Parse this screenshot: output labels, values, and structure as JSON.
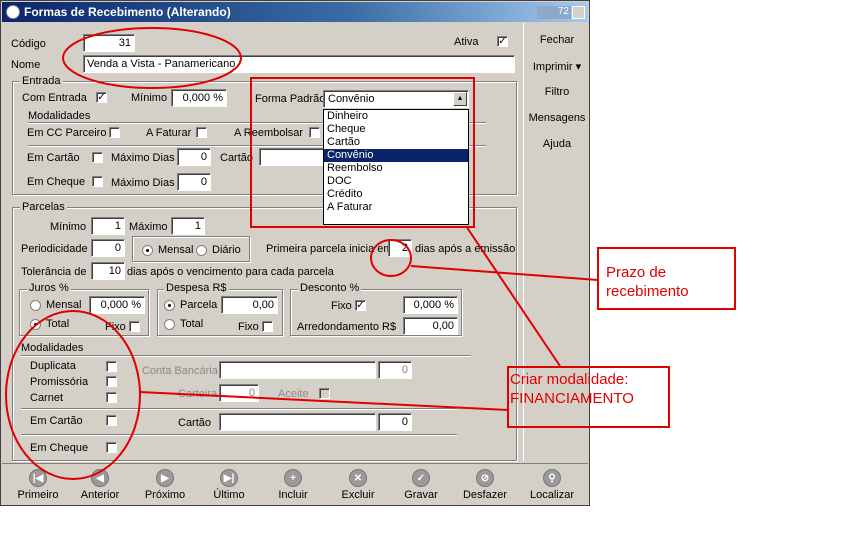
{
  "window": {
    "title": "Formas de Recebimento (Alterando)",
    "counter": "72"
  },
  "header": {
    "codigo_label": "Código",
    "codigo_value": "31",
    "ativa_label": "Ativa",
    "ativa_checked": "✓",
    "nome_label": "Nome",
    "nome_value": "Venda a Vista - Panamericano"
  },
  "entrada": {
    "group_label": "Entrada",
    "com_entrada_label": "Com Entrada",
    "com_entrada_checked": "✓",
    "minimo_label": "Mínimo",
    "minimo_value": "0,000 %",
    "forma_padrao_label": "Forma Padrão",
    "forma_padrao_value": "Convênio",
    "modalidades_label": "Modalidades",
    "em_cc_parceiro_label": "Em CC Parceiro",
    "a_faturar_label": "A Faturar",
    "a_reembolsar_label": "A Reembolsar",
    "em_cartao_label": "Em Cartão",
    "maximo_dias_label": "Máximo Dias",
    "maximo_dias_cartao_value": "0",
    "cartao_label": "Cartão",
    "em_cheque_label": "Em Cheque",
    "maximo_dias_cheque_value": "0"
  },
  "dropdown": {
    "options": [
      "Dinheiro",
      "Cheque",
      "Cartão",
      "Convênio",
      "Reembolso",
      "DOC",
      "Crédito",
      "A Faturar"
    ],
    "selected": "Convênio"
  },
  "parcelas": {
    "group_label": "Parcelas",
    "minimo_label": "Mínimo",
    "minimo_value": "1",
    "maximo_label": "Máximo",
    "maximo_value": "1",
    "periodicidade_label": "Periodicidade",
    "periodicidade_value": "0",
    "mensal_label": "Mensal",
    "diario_label": "Diário",
    "primeira_parcela_label": "Primeira parcela inicia em",
    "primeira_parcela_value": "2",
    "dias_apos_emissao_label": "dias após a emissão",
    "tolerancia_label": "Tolerância de",
    "tolerancia_value": "10",
    "tolerancia_suffix": "dias após o vencimento para cada parcela",
    "juros_label": "Juros %",
    "juros_mensal_label": "Mensal",
    "juros_total_label": "Total",
    "juros_value": "0,000 %",
    "juros_fixo_label": "Fixo",
    "despesa_label": "Despesa R$",
    "despesa_parcela_label": "Parcela",
    "despesa_total_label": "Total",
    "despesa_value": "0,00",
    "despesa_fixo_label": "Fixo",
    "desconto_label": "Desconto %",
    "desconto_fixo_label": "Fixo",
    "desconto_fixo_checked": "✓",
    "desconto_value": "0,000 %",
    "arredondamento_label": "Arredondamento R$",
    "arredondamento_value": "0,00",
    "modalidades_label": "Modalidades",
    "duplicata_label": "Duplicata",
    "promissoria_label": "Promissória",
    "carnet_label": "Carnet",
    "conta_bancaria_label": "Conta Bancária",
    "conta_bancaria_value": "0",
    "carteira_label": "Carteira",
    "carteira_value": "0",
    "aceite_label": "Aceite",
    "em_cartao_label": "Em Cartão",
    "cartao_label": "Cartão",
    "cartao_value": "0",
    "em_cheque_label": "Em Cheque"
  },
  "sidebar": {
    "fechar": "Fechar",
    "imprimir": "Imprimir",
    "imprimir_arrow": "▾",
    "filtro": "Filtro",
    "mensagens": "Mensagens",
    "ajuda": "Ajuda"
  },
  "nav": [
    {
      "label": "Primeiro",
      "icon": "first-icon",
      "glyph": "|◀"
    },
    {
      "label": "Anterior",
      "icon": "previous-icon",
      "glyph": "◀"
    },
    {
      "label": "Próximo",
      "icon": "next-icon",
      "glyph": "▶"
    },
    {
      "label": "Último",
      "icon": "last-icon",
      "glyph": "▶|"
    },
    {
      "label": "Incluir",
      "icon": "plus-icon",
      "glyph": "+"
    },
    {
      "label": "Excluir",
      "icon": "delete-icon",
      "glyph": "✕"
    },
    {
      "label": "Gravar",
      "icon": "check-icon",
      "glyph": "✓"
    },
    {
      "label": "Desfazer",
      "icon": "undo-icon",
      "glyph": "⊘"
    },
    {
      "label": "Localizar",
      "icon": "search-icon",
      "glyph": "⚲"
    }
  ],
  "annotations": {
    "prazo_line1": "Prazo de",
    "prazo_line2": "recebimento",
    "criar_line1": "Criar modalidade:",
    "criar_line2": "FINANCIAMENTO",
    "color": "#e00000"
  }
}
